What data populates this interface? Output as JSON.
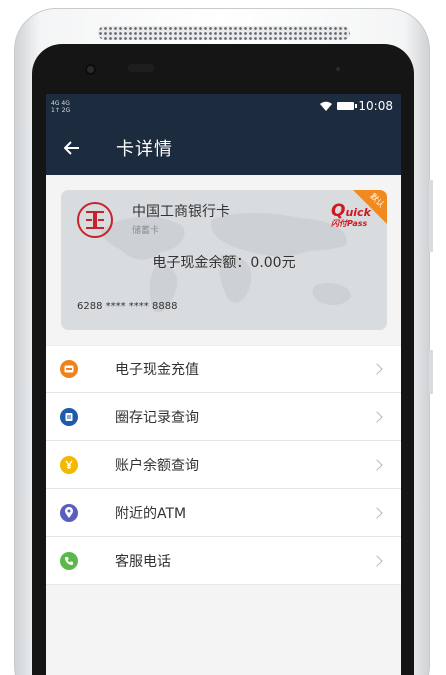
{
  "status_bar": {
    "signal_line1": "4G 4G",
    "signal_line2": "1↑ 2G",
    "time": "10:08"
  },
  "app_bar": {
    "back_icon": "arrow-left-icon",
    "title": "卡详情"
  },
  "card": {
    "bank_name": "中国工商银行卡",
    "card_type": "储蓄卡",
    "balance_text": "电子现金余额：0.00元",
    "card_number": "6288 **** **** 8888",
    "quickpass_q": "Q",
    "quickpass_rest": "uick",
    "quickpass_sub": "闪付Pass",
    "default_badge": "默认",
    "colors": {
      "logo": "#c7232b",
      "quickpass": "#d0181e",
      "badge": "#f08a1e"
    }
  },
  "menu": {
    "items": [
      {
        "label": "电子现金充值",
        "icon": "wallet-icon",
        "color": "#f0821e"
      },
      {
        "label": "圈存记录查询",
        "icon": "record-icon",
        "color": "#1e5aa8"
      },
      {
        "label": "账户余额查询",
        "icon": "yuan-coin-icon",
        "color": "#f5b800"
      },
      {
        "label": "附近的ATM",
        "icon": "location-pin-icon",
        "color": "#5a5fbf"
      },
      {
        "label": "客服电话",
        "icon": "phone-icon",
        "color": "#5cb84b"
      }
    ]
  }
}
